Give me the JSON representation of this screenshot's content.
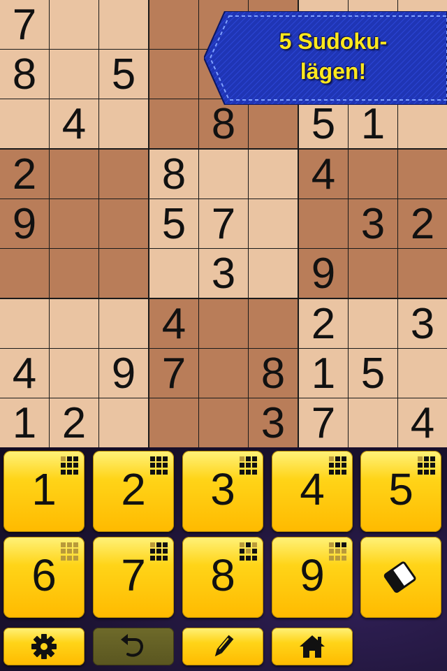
{
  "banner": {
    "line1": "5 Sudoku-",
    "line2": "lägen!"
  },
  "grid": [
    [
      "7",
      "",
      "",
      "",
      "",
      "",
      "",
      "",
      ""
    ],
    [
      "8",
      "",
      "5",
      "",
      "",
      "",
      "",
      "",
      ""
    ],
    [
      "",
      "4",
      "",
      "",
      "8",
      "",
      "5",
      "1",
      ""
    ],
    [
      "2",
      "",
      "",
      "8",
      "",
      "",
      "4",
      "",
      ""
    ],
    [
      "9",
      "",
      "",
      "5",
      "7",
      "",
      "",
      "3",
      "2"
    ],
    [
      "",
      "",
      "",
      "",
      "3",
      "",
      "9",
      "",
      ""
    ],
    [
      "",
      "",
      "",
      "4",
      "",
      "",
      "2",
      "",
      "3"
    ],
    [
      "4",
      "",
      "9",
      "7",
      "",
      "8",
      "1",
      "5",
      ""
    ],
    [
      "1",
      "2",
      "",
      "",
      "",
      "3",
      "7",
      "",
      "4"
    ]
  ],
  "keypad": {
    "digits": [
      {
        "label": "1",
        "minigrid": [
          0,
          1,
          1,
          1,
          1,
          1,
          1,
          1,
          1
        ]
      },
      {
        "label": "2",
        "minigrid": [
          1,
          1,
          1,
          1,
          1,
          1,
          1,
          1,
          1
        ]
      },
      {
        "label": "3",
        "minigrid": [
          0,
          1,
          1,
          1,
          1,
          1,
          1,
          1,
          1
        ]
      },
      {
        "label": "4",
        "minigrid": [
          0,
          1,
          1,
          1,
          1,
          1,
          1,
          1,
          1
        ]
      },
      {
        "label": "5",
        "minigrid": [
          0,
          1,
          1,
          1,
          1,
          1,
          1,
          1,
          1
        ]
      },
      {
        "label": "6",
        "minigrid": [
          0,
          0,
          0,
          0,
          0,
          0,
          0,
          0,
          0
        ]
      },
      {
        "label": "7",
        "minigrid": [
          0,
          1,
          1,
          1,
          1,
          1,
          1,
          1,
          1
        ]
      },
      {
        "label": "8",
        "minigrid": [
          0,
          1,
          0,
          1,
          0,
          1,
          1,
          1,
          1
        ]
      },
      {
        "label": "9",
        "minigrid": [
          0,
          1,
          1,
          0,
          0,
          0,
          0,
          0,
          0
        ]
      }
    ],
    "eraser_icon": "eraser-icon"
  },
  "toolbar": {
    "settings_icon": "gear-icon",
    "undo_icon": "undo-icon",
    "pencil_icon": "pencil-icon",
    "home_icon": "home-icon"
  },
  "colors": {
    "cell_light": "#eac4a2",
    "cell_dark": "#b97d59",
    "banner_blue": "#1f35b5",
    "banner_text": "#ffe81e",
    "key_yellow": "#ffd418"
  }
}
